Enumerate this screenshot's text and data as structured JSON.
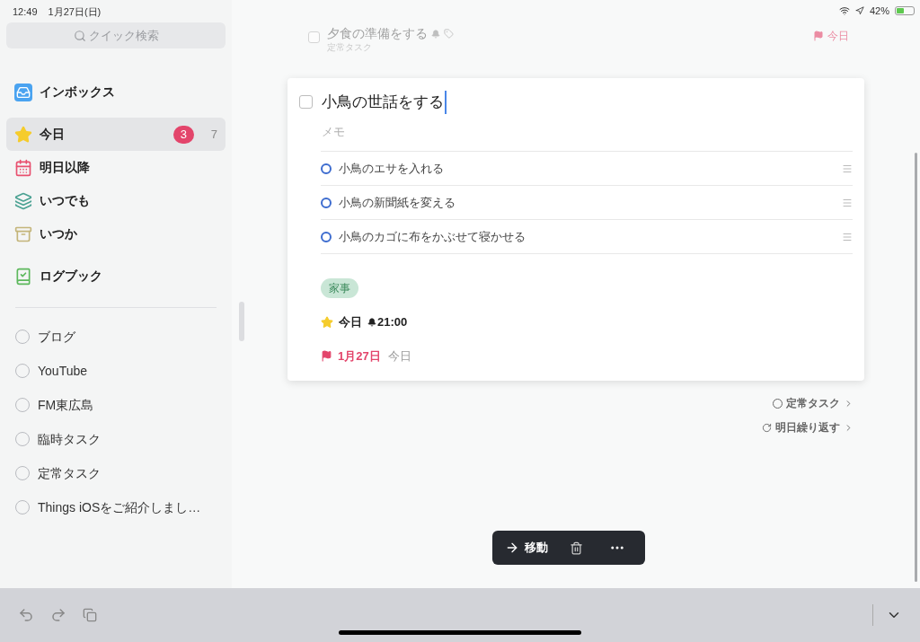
{
  "status_bar": {
    "time": "12:49",
    "date": "1月27日(日)",
    "battery": "42%"
  },
  "sidebar": {
    "search": {
      "placeholder": "クイック検索"
    },
    "nav": [
      {
        "kind": "inbox",
        "label": "インボックス",
        "selected": false
      },
      {
        "kind": "today",
        "label": "今日",
        "selected": true,
        "badge": "3",
        "count": "7"
      },
      {
        "kind": "upcoming",
        "label": "明日以降",
        "selected": false
      },
      {
        "kind": "anytime",
        "label": "いつでも",
        "selected": false
      },
      {
        "kind": "someday",
        "label": "いつか",
        "selected": false
      },
      {
        "kind": "logbook",
        "label": "ログブック",
        "selected": false
      }
    ],
    "projects": [
      {
        "label": "ブログ"
      },
      {
        "label": "YouTube"
      },
      {
        "label": "FM東広島"
      },
      {
        "label": "臨時タスク"
      },
      {
        "label": "定常タスク"
      },
      {
        "label": "Things iOSをご紹介しまし…"
      }
    ]
  },
  "background_task": {
    "title": "夕食の準備をする",
    "project": "定常タスク",
    "deadline": "今日",
    "checked": false
  },
  "task": {
    "title": "小鳥の世話をする",
    "checked": false,
    "notes": {
      "placeholder": "メモ"
    },
    "checklist": [
      {
        "label": "小鳥のエサを入れる",
        "checked": false
      },
      {
        "label": "小鳥の新聞紙を変える",
        "checked": false
      },
      {
        "label": "小鳥のカゴに布をかぶせて寝かせる",
        "checked": false
      }
    ],
    "tags": [
      "家事"
    ],
    "when": "今日",
    "reminder": "21:00",
    "deadline": "1月27日",
    "deadline_relative": "今日"
  },
  "side_links": [
    {
      "kind": "project",
      "label": "定常タスク"
    },
    {
      "kind": "repeat",
      "label": "明日繰り返す"
    }
  ],
  "action_bar": {
    "move": "移動"
  }
}
